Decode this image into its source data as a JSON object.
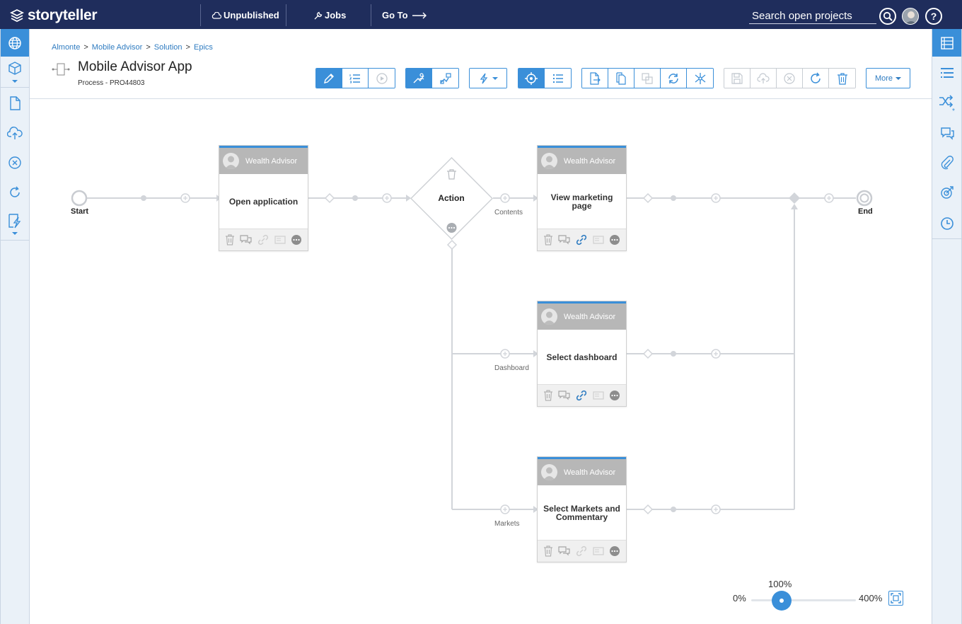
{
  "app": {
    "brand": "storyteller",
    "nav": {
      "unpublished": "Unpublished",
      "jobs": "Jobs",
      "goto": "Go To"
    },
    "search_placeholder": "Search open projects",
    "help": "?"
  },
  "breadcrumb": [
    "Almonte",
    "Mobile Advisor",
    "Solution",
    "Epics"
  ],
  "breadcrumb_sep": ">",
  "title": "Mobile Advisor App",
  "subtitle": "Process - PRO44803",
  "toolbar": {
    "more_label": "More"
  },
  "diagram": {
    "start_label": "Start",
    "end_label": "End",
    "decision_label": "Action",
    "branches": [
      "Contents",
      "Dashboard",
      "Markets"
    ],
    "cards": [
      {
        "actor": "Wealth Advisor",
        "title": "Open application"
      },
      {
        "actor": "Wealth Advisor",
        "title": "View marketing page"
      },
      {
        "actor": "Wealth Advisor",
        "title": "Select dashboard"
      },
      {
        "actor": "Wealth Advisor",
        "title": "Select Markets and Commentary"
      }
    ]
  },
  "zoom": {
    "current": "100%",
    "min": "0%",
    "max": "400%",
    "level_percent": 100
  },
  "colors": {
    "topbar": "#1f2d5c",
    "accent": "#3a8fd9",
    "rail": "#eaf1f8",
    "card_head": "#b7b7b7"
  }
}
